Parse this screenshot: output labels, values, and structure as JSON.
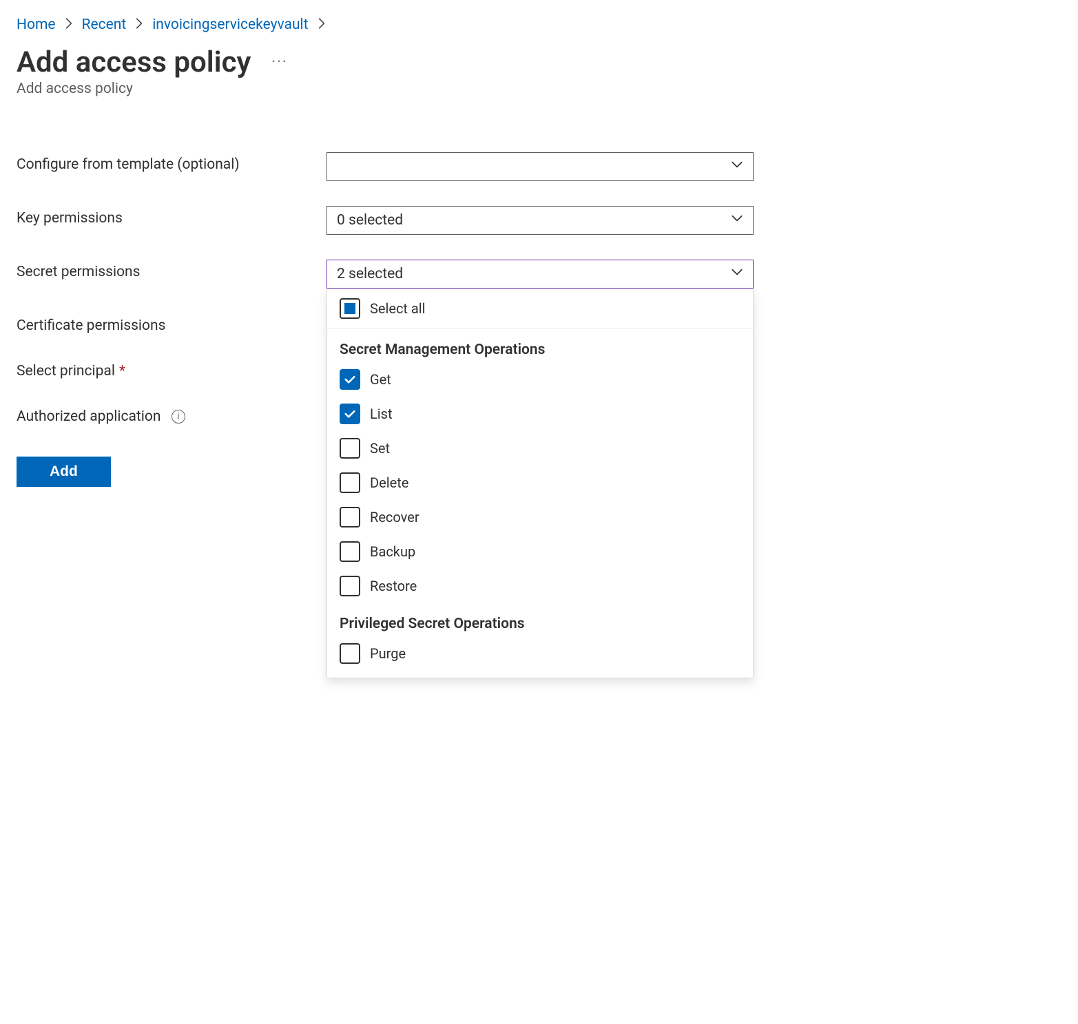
{
  "breadcrumb": {
    "items": [
      {
        "label": "Home"
      },
      {
        "label": "Recent"
      },
      {
        "label": "invoicingservicekeyvault"
      }
    ]
  },
  "page": {
    "title": "Add access policy",
    "subtitle": "Add access policy"
  },
  "form": {
    "template_label": "Configure from template (optional)",
    "template_value": "",
    "key_perms_label": "Key permissions",
    "key_perms_value": "0 selected",
    "secret_perms_label": "Secret permissions",
    "secret_perms_value": "2 selected",
    "cert_perms_label": "Certificate permissions",
    "principal_label": "Select principal",
    "auth_app_label": "Authorized application",
    "add_button": "Add"
  },
  "secret_dropdown": {
    "select_all_label": "Select all",
    "groups": [
      {
        "title": "Secret Management Operations",
        "options": [
          {
            "label": "Get",
            "checked": true
          },
          {
            "label": "List",
            "checked": true
          },
          {
            "label": "Set",
            "checked": false
          },
          {
            "label": "Delete",
            "checked": false
          },
          {
            "label": "Recover",
            "checked": false
          },
          {
            "label": "Backup",
            "checked": false
          },
          {
            "label": "Restore",
            "checked": false
          }
        ]
      },
      {
        "title": "Privileged Secret Operations",
        "options": [
          {
            "label": "Purge",
            "checked": false
          }
        ]
      }
    ]
  }
}
